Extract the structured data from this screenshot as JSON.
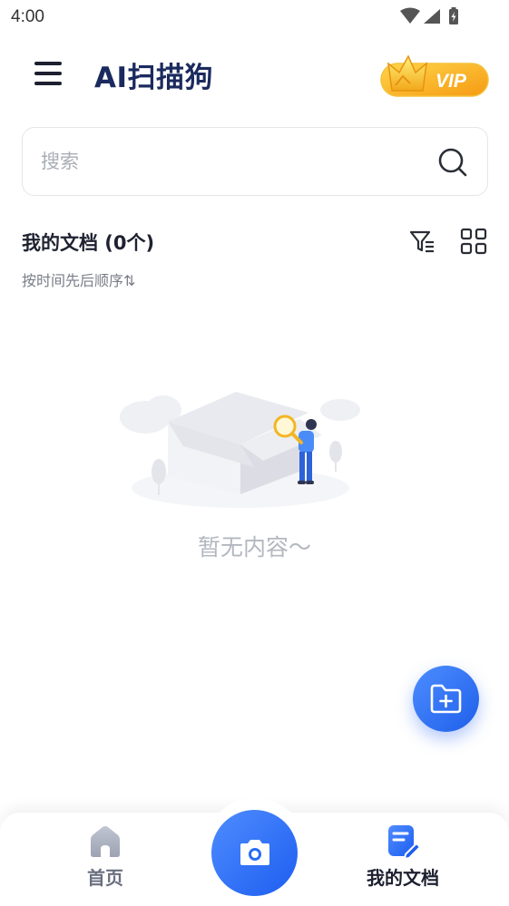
{
  "status_bar": {
    "time": "4:00"
  },
  "header": {
    "title": "AI扫描狗",
    "vip_label": "VIP"
  },
  "search": {
    "placeholder": "搜索",
    "value": ""
  },
  "documents": {
    "title": "我的文档 (0个)",
    "sort_label": "按时间先后顺序⇅",
    "empty_text": "暂无内容～"
  },
  "bottom_nav": {
    "items": [
      {
        "label": "首页",
        "icon": "home-icon",
        "active": false
      },
      {
        "label": "我的文档",
        "icon": "document-edit-icon",
        "active": true
      }
    ],
    "center_icon": "camera-icon"
  },
  "colors": {
    "title": "#1b2a5e",
    "accent_blue": "#2a6cf5",
    "vip_gold": "#f7a21b",
    "muted_text": "#7a7e88",
    "empty_text": "#b3b7bf"
  }
}
